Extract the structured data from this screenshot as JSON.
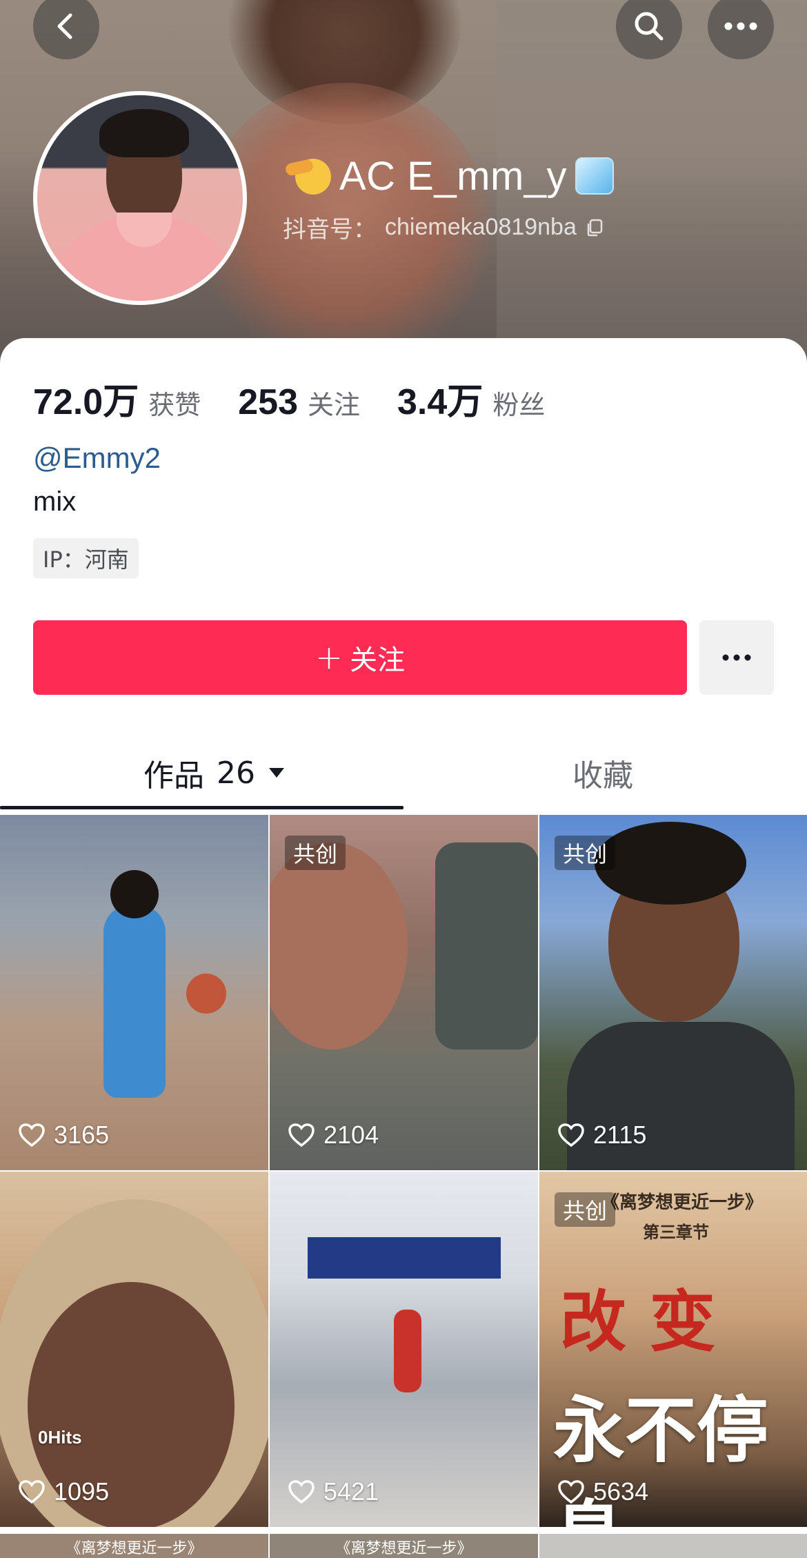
{
  "profile": {
    "display_name": "AC E_mm_y",
    "name_emoji_before": "saluting-face-emoji",
    "name_emoji_after": "ice-cube-emoji",
    "handle_label": "抖音号：",
    "handle_value": "chiemeka0819nba",
    "username_tag": "@Emmy2",
    "bio": "mix",
    "ip_label": "IP：河南"
  },
  "stats": [
    {
      "value": "72.0万",
      "label": "获赞"
    },
    {
      "value": "253",
      "label": "关注"
    },
    {
      "value": "3.4万",
      "label": "粉丝"
    }
  ],
  "actions": {
    "follow_label": "关注",
    "follow_plus": "+"
  },
  "tabs": {
    "works_label": "作品",
    "works_count": "26",
    "favorites_label": "收藏"
  },
  "videos": [
    {
      "likes": "3165",
      "co_create": ""
    },
    {
      "likes": "2104",
      "co_create": "共创"
    },
    {
      "likes": "2115",
      "co_create": "共创"
    },
    {
      "likes": "1095",
      "co_create": "",
      "overlay_text": "0Hits"
    },
    {
      "likes": "5421",
      "co_create": ""
    },
    {
      "likes": "5634",
      "co_create": "共创",
      "title_top": "《离梦想更近一步》",
      "chapter": "第三章节",
      "headline_1": "改 变",
      "headline_2": "永不停息"
    }
  ],
  "partial_row": [
    "《离梦想更近一步》",
    "《离梦想更近一步》",
    ""
  ],
  "colors": {
    "follow_button": "#fe2c55",
    "username_link": "#2b5c8f",
    "text_primary": "#161823",
    "text_secondary": "#6b6d75"
  },
  "icons": [
    "back-icon",
    "search-icon",
    "more-icon",
    "copy-icon",
    "heart-icon",
    "dropdown-icon"
  ]
}
